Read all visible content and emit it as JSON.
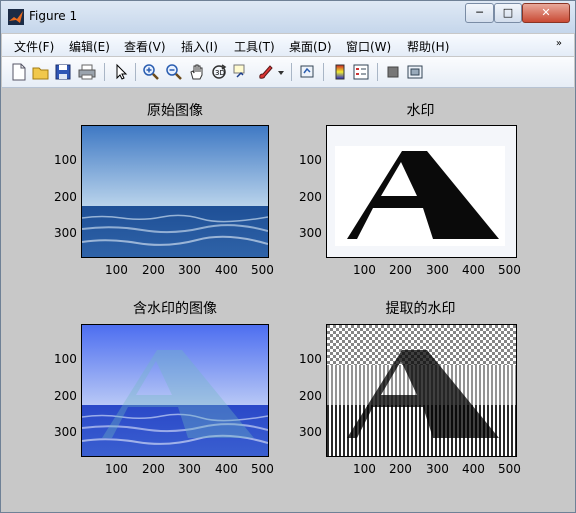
{
  "window": {
    "title": "Figure 1",
    "minimize_label": "─",
    "maximize_label": "□",
    "close_label": "✕"
  },
  "menu": [
    "文件(F)",
    "编辑(E)",
    "查看(V)",
    "插入(I)",
    "工具(T)",
    "桌面(D)",
    "窗口(W)",
    "帮助(H)"
  ],
  "menu_overflow": "»",
  "toolbar_icons": [
    "new-figure-icon",
    "open-file-icon",
    "save-icon",
    "print-icon",
    "pointer-icon",
    "zoom-in-icon",
    "zoom-out-icon",
    "pan-icon",
    "rotate-3d-icon",
    "data-cursor-icon",
    "brush-icon",
    "brush-dropdown-icon",
    "link-plot-icon",
    "colorbar-icon",
    "legend-icon",
    "hide-plot-tools-icon",
    "show-plot-tools-icon"
  ],
  "subplots": [
    {
      "title": "原始图像",
      "y_ticks": [
        "100",
        "200",
        "300"
      ],
      "x_ticks": [
        "100",
        "200",
        "300",
        "400",
        "500"
      ]
    },
    {
      "title": "水印",
      "y_ticks": [
        "100",
        "200",
        "300"
      ],
      "x_ticks": [
        "100",
        "200",
        "300",
        "400",
        "500"
      ]
    },
    {
      "title": "含水印的图像",
      "y_ticks": [
        "100",
        "200",
        "300"
      ],
      "x_ticks": [
        "100",
        "200",
        "300",
        "400",
        "500"
      ]
    },
    {
      "title": "提取的水印",
      "y_ticks": [
        "100",
        "200",
        "300"
      ],
      "x_ticks": [
        "100",
        "200",
        "300",
        "400",
        "500"
      ]
    }
  ],
  "colors": {
    "titlebar": "#dfe9f5",
    "figure_bg": "#c8c8c8",
    "close_button": "#c94a34"
  }
}
